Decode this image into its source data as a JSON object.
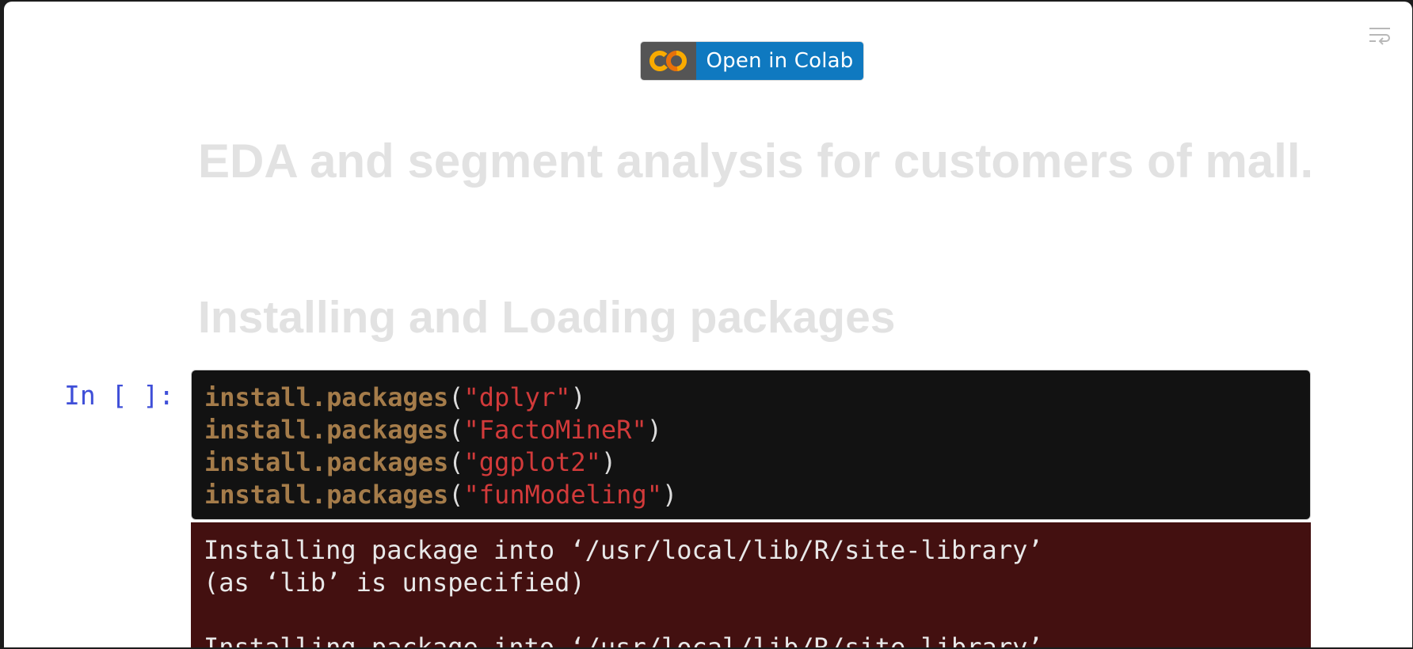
{
  "badge": {
    "label": "Open in Colab",
    "logo_icon": "colab-logo-icon",
    "colors": {
      "logo_bg": "#555555",
      "label_bg": "#0f79c0",
      "logo_orange": "#f9ab00",
      "logo_orange_dark": "#e8710a"
    }
  },
  "toolbar": {
    "wrap_icon": "wrap-lines-icon"
  },
  "notebook": {
    "title": "EDA and segment analysis for customers of mall.",
    "section_heading": "Installing and Loading packages",
    "cell": {
      "prompt": "In [ ]:",
      "lines": [
        {
          "fn": "install.packages",
          "open": "(",
          "arg": "\"dplyr\"",
          "close": ")"
        },
        {
          "fn": "install.packages",
          "open": "(",
          "arg": "\"FactoMineR\"",
          "close": ")"
        },
        {
          "fn": "install.packages",
          "open": "(",
          "arg": "\"ggplot2\"",
          "close": ")"
        },
        {
          "fn": "install.packages",
          "open": "(",
          "arg": "\"funModeling\"",
          "close": ")"
        }
      ]
    },
    "output": {
      "lines": [
        "Installing package into ‘/usr/local/lib/R/site-library’",
        "(as ‘lib’ is unspecified)",
        "",
        "Installing package into ‘/usr/local/lib/R/site-library’"
      ]
    }
  },
  "colors": {
    "heading_text": "#e2e2e2",
    "prompt_text": "#3f4fd8",
    "code_bg": "#121212",
    "code_function": "#a57c4a",
    "code_string": "#d23a3a",
    "output_bg": "#431010"
  }
}
